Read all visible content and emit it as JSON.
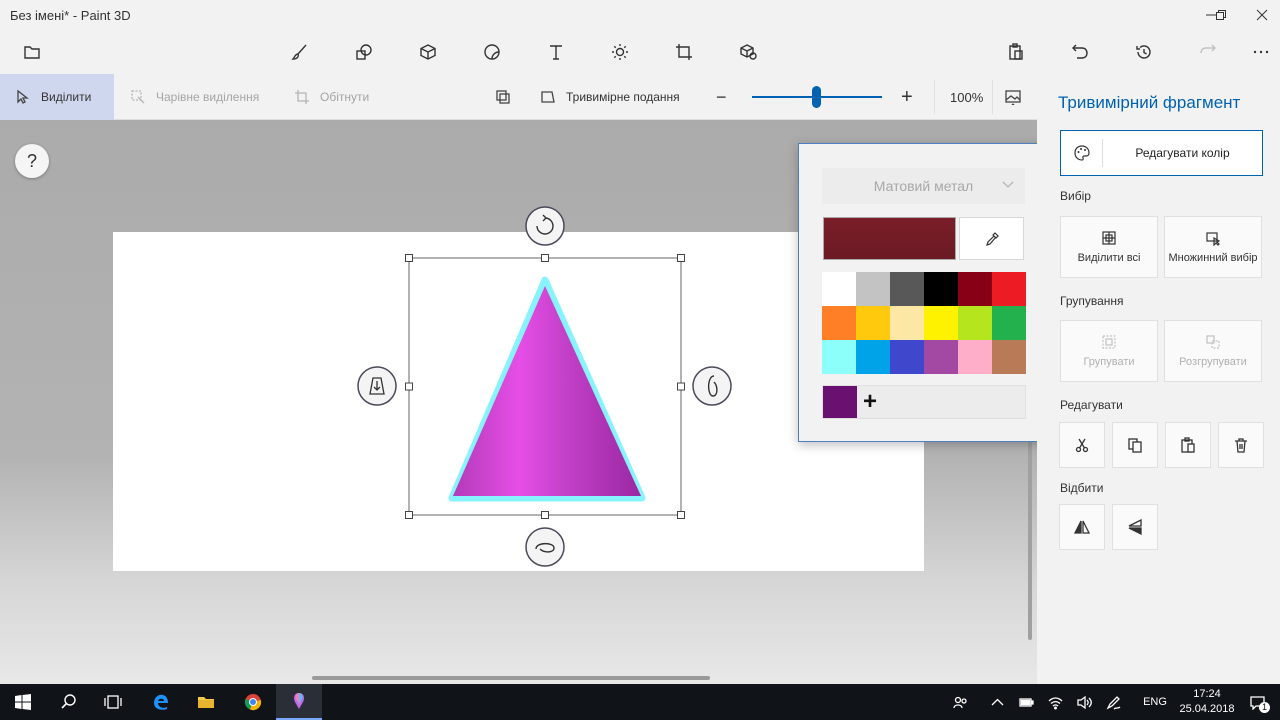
{
  "window": {
    "title": "Без імені* - Paint 3D"
  },
  "toolbar": {
    "tools": [
      "menu-icon",
      "brushes-icon",
      "2d-shapes-icon",
      "3d-shapes-icon",
      "stickers-icon",
      "text-icon",
      "effects-icon",
      "canvas-icon",
      "3d-library-icon"
    ],
    "actions": [
      "paste-icon",
      "undo-icon",
      "history-icon",
      "redo-icon",
      "more-icon"
    ]
  },
  "subbar": {
    "select_label": "Виділити",
    "magic_select_label": "Чарівне виділення",
    "crop_label": "Обітнути",
    "view_3d_label": "Тривимірне подання",
    "zoom_minus": "−",
    "zoom_plus": "+",
    "zoom_value": "100%",
    "zoom_fraction": 0.47
  },
  "help": {
    "label": "?"
  },
  "color_flyout": {
    "material_label": "Матовий метал",
    "current_color": "#6b1a24",
    "palette": [
      "#ffffff",
      "#c3c3c3",
      "#585858",
      "#000000",
      "#880015",
      "#ed1c24",
      "#ff7f27",
      "#ffc90e",
      "#fce8a4",
      "#fff200",
      "#b5e61d",
      "#22b14c",
      "#8cfffb",
      "#00a2e8",
      "#3f48cc",
      "#a349a4",
      "#ffaec9",
      "#b97a57"
    ],
    "custom_color": "#6a1070",
    "add_label": "+"
  },
  "panel": {
    "title": "Тривимірний фрагмент",
    "edit_color_label": "Редагувати колір",
    "selection_section": "Вибір",
    "select_all_label": "Виділити всі",
    "multi_select_label": "Множинний вибір",
    "group_section": "Групування",
    "group_label": "Групувати",
    "ungroup_label": "Розгрупувати",
    "edit_section": "Редагувати",
    "mirror_section": "Відбити"
  },
  "taskbar": {
    "lang": "ENG",
    "time": "17:24",
    "date": "25.04.2018",
    "notifications_count": "1"
  },
  "colors": {
    "accent": "#0063b1",
    "shape_light": "#e24ee0",
    "shape_dark": "#9c27a4",
    "shape_glow": "#86f3ff"
  }
}
